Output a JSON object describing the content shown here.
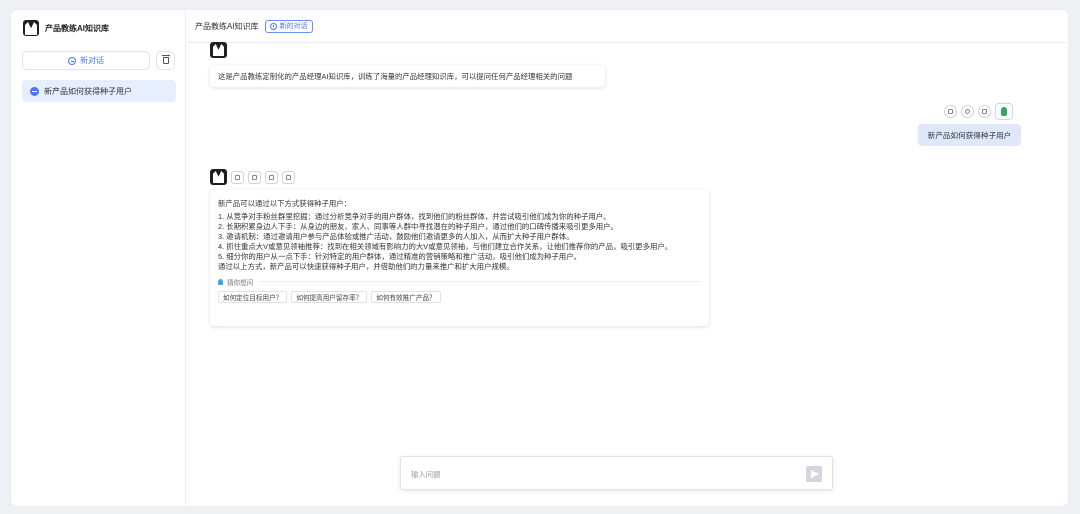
{
  "app": {
    "title": "产品教练AI知识库"
  },
  "sidebar": {
    "new_chat_label": "新对话",
    "sessions": [
      {
        "label": "新产品如何获得种子用户"
      }
    ]
  },
  "header": {
    "title": "产品教练AI知识库",
    "badge": "新的对话"
  },
  "messages": {
    "greeting": "这是产品教练定制化的产品经理AI知识库，训练了海量的产品经理知识库，可以提问任何产品经理相关的问题",
    "user_question": "新产品如何获得种子用户",
    "answer": {
      "intro": "新产品可以通过以下方式获得种子用户：",
      "lines": [
        "1. 从竞争对手粉丝群里挖掘：通过分析竞争对手的用户群体，找到他们的粉丝群体，并尝试吸引他们成为你的种子用户。",
        "2. 长期积累身边人下手：从身边的朋友、家人、同事等人群中寻找潜在的种子用户，通过他们的口碑传播来吸引更多用户。",
        "3. 邀请机制：通过邀请用户参与产品体验或推广活动，鼓励他们邀请更多的人加入，从而扩大种子用户群体。",
        "4. 抓住重点大V或意见领袖推荐：找到在相关领域有影响力的大V或意见领袖，与他们建立合作关系，让他们推荐你的产品，吸引更多用户。",
        "5. 细分你的用户从一点下手：针对特定的用户群体，通过精准的营销策略和推广活动，吸引他们成为种子用户。",
        "通过以上方式，新产品可以快速获得种子用户，并借助他们的力量来推广和扩大用户规模。"
      ],
      "guess_label": "猜你想问",
      "suggestions": [
        "如何定位目标用户？",
        "如何提高用户留存率？",
        "如何有效推广产品？"
      ]
    }
  },
  "input": {
    "placeholder": "输入问题"
  },
  "icons": {
    "logo": "suit-avatar-icon",
    "new_chat": "chat-bubble-icon",
    "clear": "trash-icon",
    "session": "chat-dot-icon",
    "badge": "clock-icon",
    "send": "send-arrow-icon"
  },
  "colors": {
    "accent": "#4d77f0",
    "selected_bg": "#e7efff",
    "user_bubble": "#dfe8fb"
  }
}
